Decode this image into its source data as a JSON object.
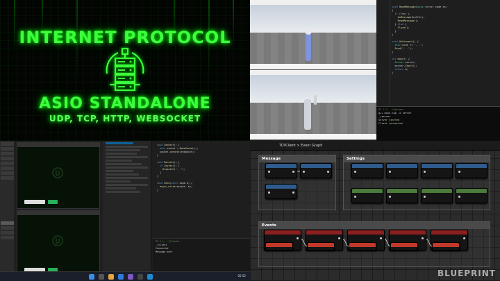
{
  "banner": {
    "title": "INTERNET PROTOCOL",
    "subtitle": "ASIO STANDALONE",
    "protocols": "UDP, TCP, HTTP, WEBSOCKET",
    "accent_color": "#3dff3d",
    "icon": "server-stack-icon"
  },
  "blueprint": {
    "window_title": "TCPClient > Event Graph",
    "watermark": "BLUEPRINT",
    "comments": [
      "Message",
      "Settings",
      "Events"
    ]
  },
  "taskbar": {
    "clock": "05:52"
  }
}
